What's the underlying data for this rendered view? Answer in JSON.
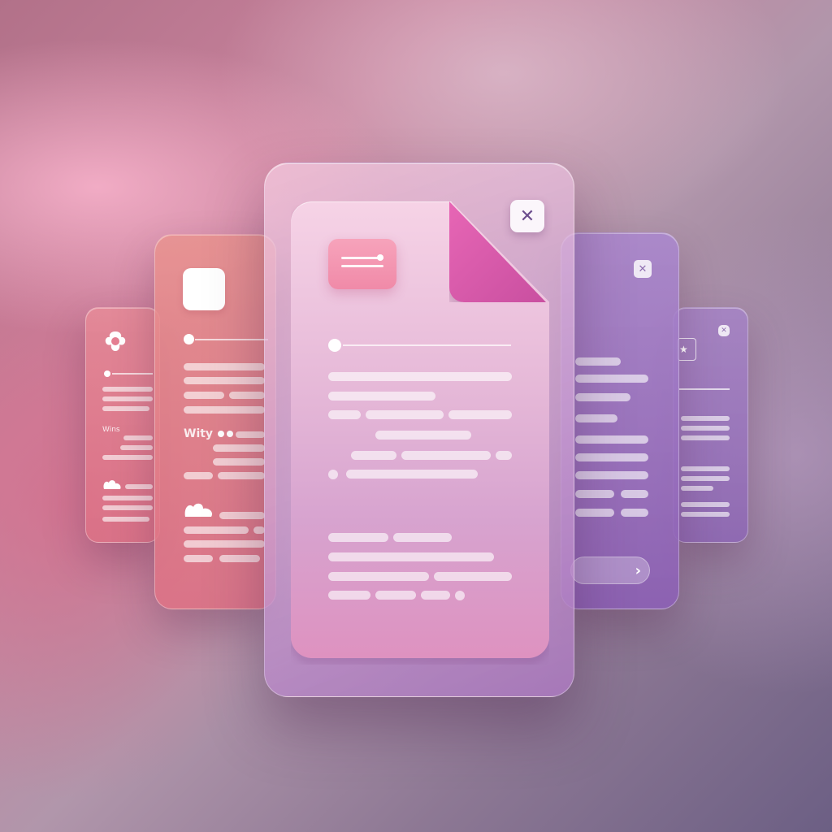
{
  "cards": {
    "far_left": {
      "label": "Wins"
    },
    "mid_left": {
      "label": "Wity"
    },
    "main": {
      "close_glyph": "✕"
    },
    "mid_right": {
      "close_glyph": "✕",
      "next_glyph": "›"
    },
    "far_right": {
      "close_glyph": "✕",
      "star_glyph": "★"
    }
  },
  "icons": [
    "menu-lines-icon",
    "close-icon",
    "square-app-icon",
    "clover-icon",
    "cloud-blob-icon",
    "star-icon",
    "chevron-right-icon",
    "document-fold-icon"
  ],
  "colors": {
    "accent_magenta": "#e766b5",
    "menu_chip_pink": "#f08aa8",
    "close_icon": "#6c4d8e"
  }
}
